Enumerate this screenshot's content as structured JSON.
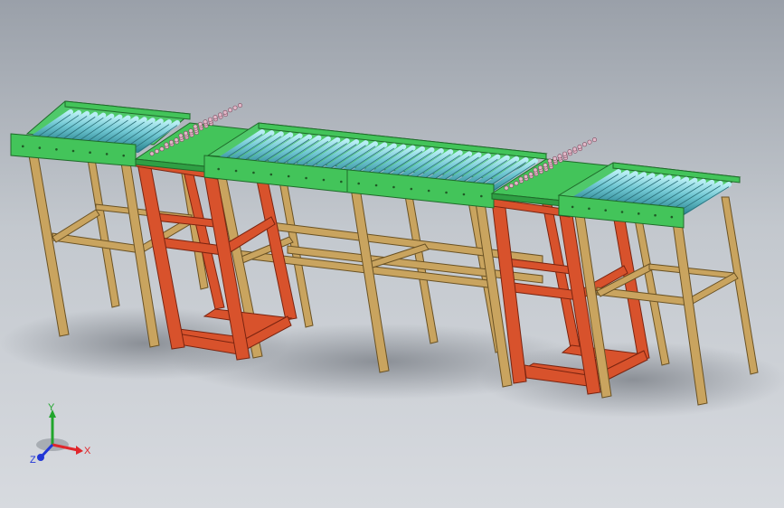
{
  "viewport": {
    "background_top": "#9aa0a9",
    "background_bottom": "#d7dadf"
  },
  "colors": {
    "wood_frame": "#c9a45f",
    "wood_frame_edge": "#6a5224",
    "red_frame": "#d8522c",
    "red_frame_edge": "#7a2410",
    "deck_green": "#43c45a",
    "deck_edge": "#1f6a2a",
    "roller_blue": "#6fc6d2",
    "roller_edge": "#2b6e79",
    "ball_pink": "#e2b8c8"
  },
  "triad": {
    "x_label": "X",
    "y_label": "Y",
    "z_label": "Z",
    "x_color": "#e0262b",
    "y_color": "#21a52c",
    "z_color": "#2236d6"
  }
}
